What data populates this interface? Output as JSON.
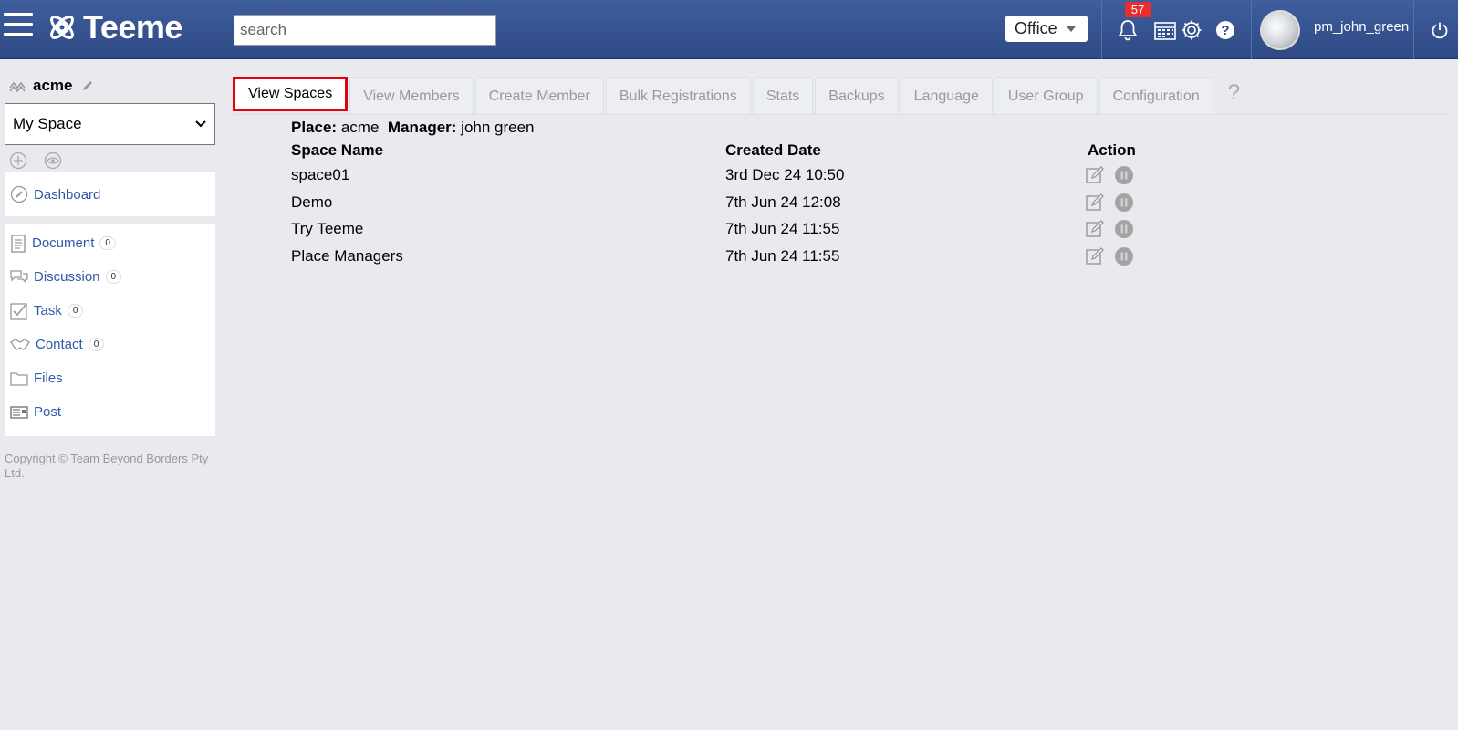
{
  "header": {
    "logo_text": "Teeme",
    "search_placeholder": "search",
    "office_label": "Office",
    "notification_count": "57",
    "username": "pm_john_green"
  },
  "sidebar": {
    "space_name": "acme",
    "space_select_value": "My Space",
    "dashboard_label": "Dashboard",
    "items": [
      {
        "label": "Document",
        "count": "0"
      },
      {
        "label": "Discussion",
        "count": "0"
      },
      {
        "label": "Task",
        "count": "0"
      },
      {
        "label": "Contact",
        "count": "0"
      },
      {
        "label": "Files"
      },
      {
        "label": "Post"
      }
    ],
    "copyright": "Copyright © Team Beyond Borders Pty Ltd."
  },
  "tabs": [
    "View Spaces",
    "View Members",
    "Create Member",
    "Bulk Registrations",
    "Stats",
    "Backups",
    "Language",
    "User Group",
    "Configuration"
  ],
  "tab_help": "?",
  "main": {
    "place_label": "Place:",
    "place_value": "acme",
    "manager_label": "Manager:",
    "manager_value": "john green",
    "columns": [
      "Space Name",
      "Created Date",
      "Action"
    ],
    "rows": [
      {
        "name": "space01",
        "created": "3rd Dec 24 10:50"
      },
      {
        "name": "Demo",
        "created": "7th Jun 24 12:08"
      },
      {
        "name": "Try Teeme",
        "created": "7th Jun 24 11:55"
      },
      {
        "name": "Place Managers",
        "created": "7th Jun 24 11:55"
      }
    ]
  },
  "colors": {
    "header_bg": "#3f5e9c",
    "link": "#2f5aa8",
    "active_tab_border": "#e3000f",
    "badge": "#e52e2e"
  }
}
